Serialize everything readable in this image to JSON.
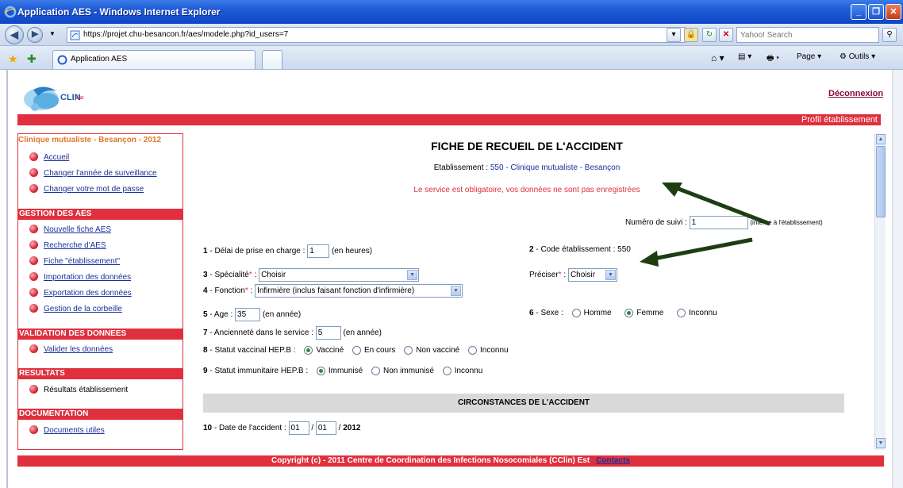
{
  "browser": {
    "title": "Application AES - Windows Internet Explorer",
    "url": "https://projet.chu-besancon.fr/aes/modele.php?id_users=7",
    "search_placeholder": "Yahoo! Search",
    "tab_label": "Application AES",
    "commands": {
      "page": "Page",
      "tools": "Outils"
    }
  },
  "header": {
    "logo_text": "CLIN",
    "logo_sub": "Est",
    "logout": "Déconnexion",
    "profile": "Profil établissement"
  },
  "sidebar": {
    "title": "Clinique mutualiste - Besançon - 2012",
    "top_items": [
      "Accueil",
      "Changer l'année de surveillance",
      "Changer votre mot de passe"
    ],
    "sections": [
      {
        "heading": "GESTION DES AES",
        "items": [
          "Nouvelle fiche AES",
          "Recherche d'AES",
          "Fiche \"établissement\"",
          "Importation des données",
          "Exportation des données",
          "Gestion de la corbeille"
        ]
      },
      {
        "heading": "VALIDATION DES DONNEES",
        "items": [
          "Valider les données"
        ]
      },
      {
        "heading": "RESULTATS",
        "items": [
          "Résultats établissement"
        ]
      },
      {
        "heading": "DOCUMENTATION",
        "items": [
          "Documents utiles"
        ]
      }
    ]
  },
  "form": {
    "title": "FICHE DE RECUEIL DE L'ACCIDENT",
    "estab_label": "Etablissement :",
    "estab_value": "550 - Clinique mutualiste - Besançon",
    "error": "Le service est obligatoire, vos données ne sont pas enregistrées",
    "suivi_label": "Numéro de suivi :",
    "suivi_value": "1",
    "suivi_note": "(interne à l'établissement)",
    "f1_num": "1",
    "f1_label": " - Délai de prise en charge :",
    "f1_value": "1",
    "f1_unit": "(en heures)",
    "f2_num": "2",
    "f2_label": " - Code établissement : 550",
    "f3_num": "3",
    "f3_label": " - Spécialité",
    "f3_value": "Choisir",
    "precise_label": "Préciser",
    "precise_value": "Choisir",
    "f4_num": "4",
    "f4_label": " - Fonction",
    "f4_value": "Infirmière (inclus faisant fonction d'infirmière)",
    "f5_num": "5",
    "f5_label": " - Age :",
    "f5_value": "35",
    "f5_unit": "(en année)",
    "f6_num": "6",
    "f6_label": " - Sexe :",
    "f6_options": [
      "Homme",
      "Femme",
      "Inconnu"
    ],
    "f6_selected": "Femme",
    "f7_num": "7",
    "f7_label": " - Ancienneté dans le service :",
    "f7_value": "5",
    "f7_unit": "(en année)",
    "f8_num": "8",
    "f8_label": " - Statut vaccinal HEP.B :",
    "f8_options": [
      "Vacciné",
      "En cours",
      "Non vacciné",
      "Inconnu"
    ],
    "f8_selected": "Vacciné",
    "f9_num": "9",
    "f9_label": " - Statut immunitaire HEP.B :",
    "f9_options": [
      "Immunisé",
      "Non immunisé",
      "Inconnu"
    ],
    "f9_selected": "Immunisé",
    "section_title": "CIRCONSTANCES DE L'ACCIDENT",
    "f10_num": "10",
    "f10_label": " - Date de l'accident :",
    "f10_day": "01",
    "f10_month": "01",
    "f10_year": "2012"
  },
  "footer": {
    "copyright": "Copyright (c) - 2011 Centre de Coordination des Infections Nosocomiales (CClin) Est",
    "contacts": "Contacts"
  },
  "colors": {
    "accent_red": "#e0303e",
    "link_blue": "#1a2f9a",
    "sidebar_title": "#e07828",
    "annotation_arrow": "#1f3d12"
  }
}
